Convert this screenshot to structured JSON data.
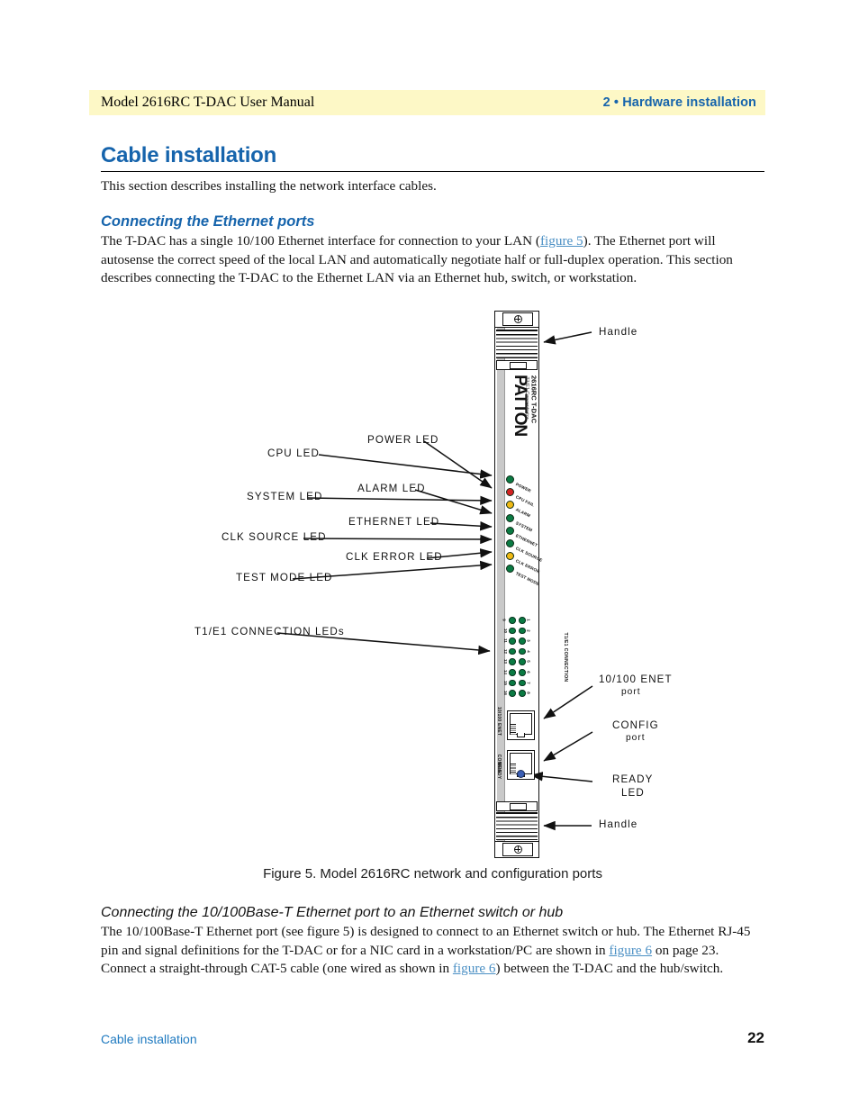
{
  "header": {
    "manual_title": "Model 2616RC T-DAC User Manual",
    "chapter": "2 • Hardware installation"
  },
  "page_title": "Cable installation",
  "intro_paragraph": "This section describes installing the network interface cables.",
  "section_ethernet": {
    "heading": "Connecting the Ethernet ports",
    "paragraph_part1": "The T-DAC has a single 10/100 Ethernet interface for connection to your LAN (",
    "xref1": "figure 5",
    "paragraph_part2": "). The Ethernet port will autosense the correct speed of the local LAN and automatically negotiate half or full-duplex operation. This section describes connecting the T-DAC to the Ethernet LAN via an Ethernet hub, switch, or workstation."
  },
  "figure": {
    "caption": "Figure 5. Model 2616RC network and configuration ports",
    "device": {
      "brand": "PATTON",
      "model": "2616RC T-DAC",
      "subtitle": "T1/E1 Concentrator",
      "status_leds": [
        {
          "label": "POWER",
          "color": "#0a7a43"
        },
        {
          "label": "CPU FAIL",
          "color": "#d42222"
        },
        {
          "label": "ALARM",
          "color": "#f0b914"
        },
        {
          "label": "SYSTEM",
          "color": "#0a7a43"
        },
        {
          "label": "ETHERNET",
          "color": "#0a7a43"
        },
        {
          "label": "CLK SOURCE",
          "color": "#0a7a43"
        },
        {
          "label": "CLK ERROR",
          "color": "#f0b914"
        },
        {
          "label": "TEST MODE",
          "color": "#0a7a43"
        }
      ],
      "t1e1_panel_label": "T1/E1 CONNECTION",
      "t1e1_left_numbers": [
        "9",
        "10",
        "11",
        "12",
        "13",
        "14",
        "15",
        "16"
      ],
      "t1e1_right_numbers": [
        "1",
        "2",
        "3",
        "4",
        "5",
        "6",
        "7",
        "8"
      ],
      "port_enet_label": "10/100 ENET",
      "port_config_label": "CONFIG",
      "ready_led_label": "READY"
    },
    "callouts": {
      "handle_top": "Handle",
      "handle_bottom": "Handle",
      "cpu_led": "CPU LED",
      "power_led": "POWER LED",
      "system_led": "SYSTEM LED",
      "alarm_led": "ALARM LED",
      "ethernet_led": "ETHERNET LED",
      "clk_source_led": "CLK SOURCE LED",
      "clk_error_led": "CLK ERROR LED",
      "test_mode_led": "TEST MODE LED",
      "t1e1_leds": "T1/E1 CONNECTION LEDs",
      "enet_port_line1": "10/100 ENET",
      "enet_port_line2": "port",
      "config_port_line1": "CONFIG",
      "config_port_line2": "port",
      "ready_led_line1": "READY",
      "ready_led_line2": "LED"
    }
  },
  "section_base_t": {
    "heading": "Connecting the 10/100Base-T Ethernet port to an Ethernet switch or hub",
    "paragraph_part1": "The 10/100Base-T Ethernet port (see figure 5) is designed to connect to an Ethernet switch or hub. The Ethernet RJ-45 pin and signal definitions for the T-DAC or for a NIC card in a workstation/PC are shown in ",
    "xref1": "figure 6",
    "paragraph_part2": " on page 23. Connect a straight-through CAT-5 cable (one wired as shown in ",
    "xref2": "figure 6",
    "paragraph_part3": ") between the T-DAC and the hub/switch."
  },
  "footer": {
    "section_name": "Cable installation",
    "page_number": "22"
  },
  "colors": {
    "accent_blue": "#1664ac",
    "link_blue": "#4a8fc4",
    "header_bg": "#fdf8c6",
    "led_green": "#0a7a43",
    "led_red": "#d42222",
    "led_yellow": "#f0b914",
    "led_blue": "#3b5fb5"
  }
}
